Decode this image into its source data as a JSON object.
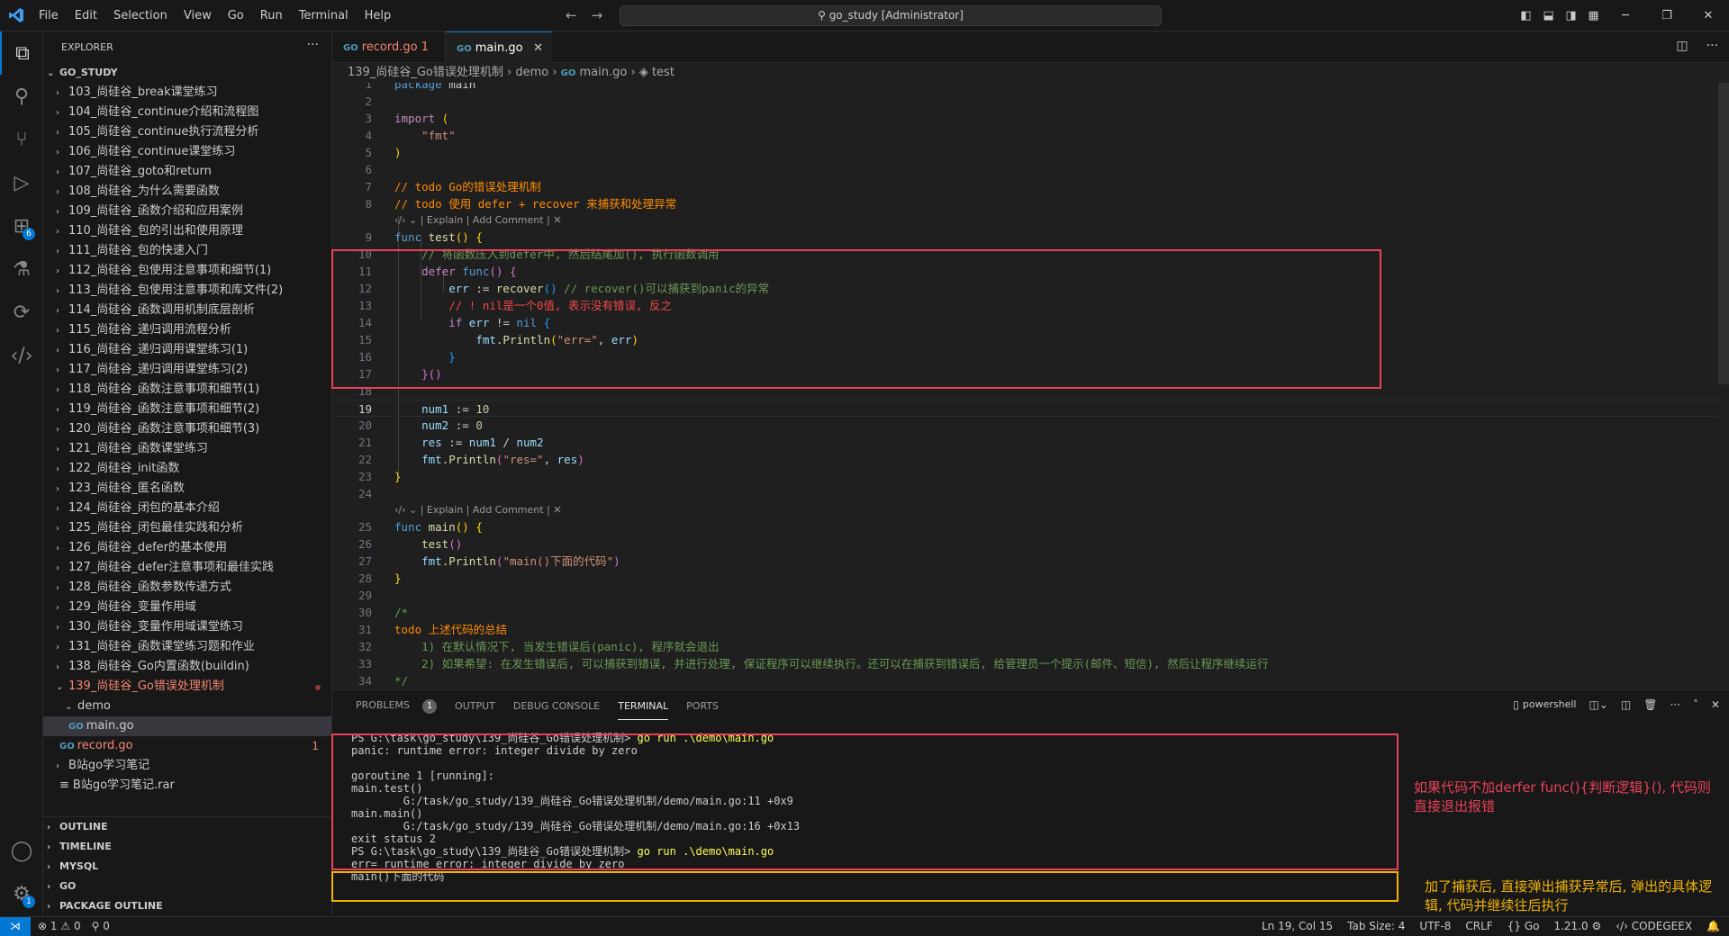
{
  "titlebar": {
    "menu": [
      "File",
      "Edit",
      "Selection",
      "View",
      "Go",
      "Run",
      "Terminal",
      "Help"
    ],
    "search": "go_study [Administrator]"
  },
  "activity": {
    "extensions_badge": "6",
    "settings_badge": "1"
  },
  "sidebar": {
    "header": "EXPLORER",
    "root": "GO_STUDY",
    "folders": [
      "103_尚硅谷_break课堂练习",
      "104_尚硅谷_continue介绍和流程图",
      "105_尚硅谷_continue执行流程分析",
      "106_尚硅谷_continue课堂练习",
      "107_尚硅谷_goto和return",
      "108_尚硅谷_为什么需要函数",
      "109_尚硅谷_函数介绍和应用案例",
      "110_尚硅谷_包的引出和使用原理",
      "111_尚硅谷_包的快速入门",
      "112_尚硅谷_包使用注意事项和细节(1)",
      "113_尚硅谷_包使用注意事项和库文件(2)",
      "114_尚硅谷_函数调用机制底层剖析",
      "115_尚硅谷_递归调用流程分析",
      "116_尚硅谷_递归调用课堂练习(1)",
      "117_尚硅谷_递归调用课堂练习(2)",
      "118_尚硅谷_函数注意事项和细节(1)",
      "119_尚硅谷_函数注意事项和细节(2)",
      "120_尚硅谷_函数注意事项和细节(3)",
      "121_尚硅谷_函数课堂练习",
      "122_尚硅谷_init函数",
      "123_尚硅谷_匿名函数",
      "124_尚硅谷_闭包的基本介绍",
      "125_尚硅谷_闭包最佳实践和分析",
      "126_尚硅谷_defer的基本使用",
      "127_尚硅谷_defer注意事项和最佳实践",
      "128_尚硅谷_函数参数传递方式",
      "129_尚硅谷_变量作用域",
      "130_尚硅谷_变量作用域课堂练习",
      "131_尚硅谷_函数课堂练习题和作业",
      "138_尚硅谷_Go内置函数(buildin)"
    ],
    "open_folder": "139_尚硅谷_Go错误处理机制",
    "subfolder": "demo",
    "selected_file": "main.go",
    "record_file": "record.go",
    "record_count": "1",
    "other_folder": "B站go学习笔记",
    "rar_file": "B站go学习笔记.rar",
    "sections": [
      "OUTLINE",
      "TIMELINE",
      "MYSQL",
      "GO",
      "PACKAGE OUTLINE"
    ]
  },
  "tabs": [
    {
      "label": "record.go",
      "badge": "1"
    },
    {
      "label": "main.go"
    }
  ],
  "breadcrumb": {
    "folder": "139_尚硅谷_Go错误处理机制",
    "sub": "demo",
    "file": "main.go",
    "symbol": "test"
  },
  "codelens": "| Explain | Add Comment |",
  "line_numbers": [
    "1",
    "2",
    "3",
    "4",
    "5",
    "6",
    "7",
    "8",
    "9",
    "10",
    "11",
    "12",
    "13",
    "14",
    "15",
    "16",
    "17",
    "18",
    "19",
    "20",
    "21",
    "22",
    "23",
    "24",
    "25",
    "26",
    "27",
    "28",
    "29",
    "30",
    "31",
    "32",
    "33",
    "34"
  ],
  "code": {
    "l1_kw": "package",
    "l1_name": " main",
    "l3_kw": "import",
    "l3_br": " (",
    "l4": "\"fmt\"",
    "l5": ")",
    "l7a": "// ",
    "l7b": "todo Go的错误处理机制",
    "l8a": "// ",
    "l8b": "todo 使用 defer + recover 来捕获和处理异常",
    "l9_kw": "func",
    "l9_fn": " test",
    "l9_rest": "() {",
    "l10": "// 将函数压入到defer中, 然后结尾加(), 执行函数调用",
    "l11_kw": "defer",
    "l11_fn": " func",
    "l11_rest": "() {",
    "l12_var": "err",
    "l12_op": " := ",
    "l12_fn": "recover",
    "l12_br": "()",
    "l12_cm": " // recover()可以捕获到panic的异常",
    "l13_cm": "// ",
    "l13_todo": "! nil是一个0值, 表示没有错误, 反之",
    "l14_kw": "if",
    "l14_var": " err",
    "l14_op": " != ",
    "l14_nil": "nil",
    "l14_br": " {",
    "l15_pkg": "fmt",
    "l15_fn": ".Println",
    "l15_str": "\"err=\"",
    "l15_var": " err",
    "l16": "}",
    "l17": "}()",
    "l19_var": "num1",
    "l19_op": " := ",
    "l19_num": "10",
    "l20_var": "num2",
    "l20_op": " := ",
    "l20_num": "0",
    "l21_var": "res",
    "l21_op": " := ",
    "l21_a": "num1",
    "l21_div": " / ",
    "l21_b": "num2",
    "l22_pkg": "fmt",
    "l22_fn": ".Println",
    "l22_str": "\"res=\"",
    "l22_var": " res",
    "l23": "}",
    "l25_kw": "func",
    "l25_fn": " main",
    "l25_rest": "() {",
    "l26_fn": "test",
    "l26_br": "()",
    "l27_pkg": "fmt",
    "l27_fn": ".Println",
    "l27_str": "\"main()下面的代码\"",
    "l28": "}",
    "l30": "/*",
    "l31": "todo 上述代码的总结",
    "l32": "    1) 在默认情况下, 当发生错误后(panic), 程序就会退出",
    "l33": "    2) 如果希望: 在发生错误后, 可以捕获到错误, 并进行处理, 保证程序可以继续执行。还可以在捕获到错误后, 给管理员一个提示(邮件、短信), 然后让程序继续运行",
    "l34": "*/"
  },
  "panel": {
    "tabs": [
      "PROBLEMS",
      "OUTPUT",
      "DEBUG CONSOLE",
      "TERMINAL",
      "PORTS"
    ],
    "problems_count": "1",
    "shell": "powershell"
  },
  "terminal": {
    "prompt1": "PS G:\\task\\go_study\\139_尚硅谷_Go错误处理机制> ",
    "cmd": "go run .\\demo\\main.go",
    "lines1": [
      "panic: runtime error: integer divide by zero",
      "",
      "goroutine 1 [running]:",
      "main.test()",
      "        G:/task/go_study/139_尚硅谷_Go错误处理机制/demo/main.go:11 +0x9",
      "main.main()",
      "        G:/task/go_study/139_尚硅谷_Go错误处理机制/demo/main.go:16 +0x13",
      "exit status 2"
    ],
    "prompt2": "PS G:\\task\\go_study\\139_尚硅谷_Go错误处理机制> ",
    "lines2": [
      "err= runtime error: integer divide by zero",
      "main()下面的代码"
    ]
  },
  "annotations": {
    "note1": "如果代码不加derfer func(){判断逻辑}(), 代码则直接退出报错",
    "note2": "加了捕获后, 直接弹出捕获异常后, 弹出的具体逻辑, 代码并继续往后执行"
  },
  "statusbar": {
    "errors": "1",
    "warnings": "0",
    "ports": "0",
    "position": "Ln 19, Col 15",
    "tab_size": "Tab Size: 4",
    "encoding": "UTF-8",
    "eol": "CRLF",
    "language": "Go",
    "version": "1.21.0",
    "ext": "CODEGEEX"
  }
}
